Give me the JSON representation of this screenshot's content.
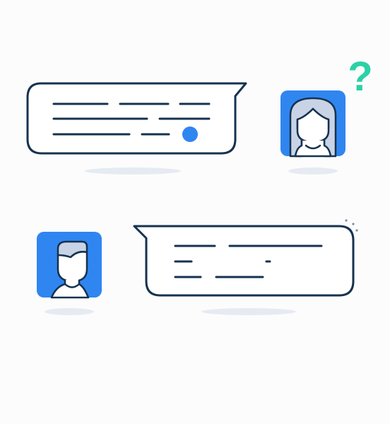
{
  "scene": {
    "question_mark": "?"
  },
  "colors": {
    "background": "#fcfcfd",
    "outline": "#16324f",
    "avatar_fill": "#2f86f0",
    "hair_fill": "#c9d3e6",
    "skin_fill": "#ffffff",
    "accent_green": "#2bd1a6",
    "shadow": "#e6ebf2"
  },
  "icons": {
    "question": "question-mark-icon",
    "sparkle": "sparkle-icon",
    "female_avatar": "female-user-avatar-icon",
    "male_avatar": "male-user-avatar-icon",
    "dot": "unread-dot-icon"
  }
}
